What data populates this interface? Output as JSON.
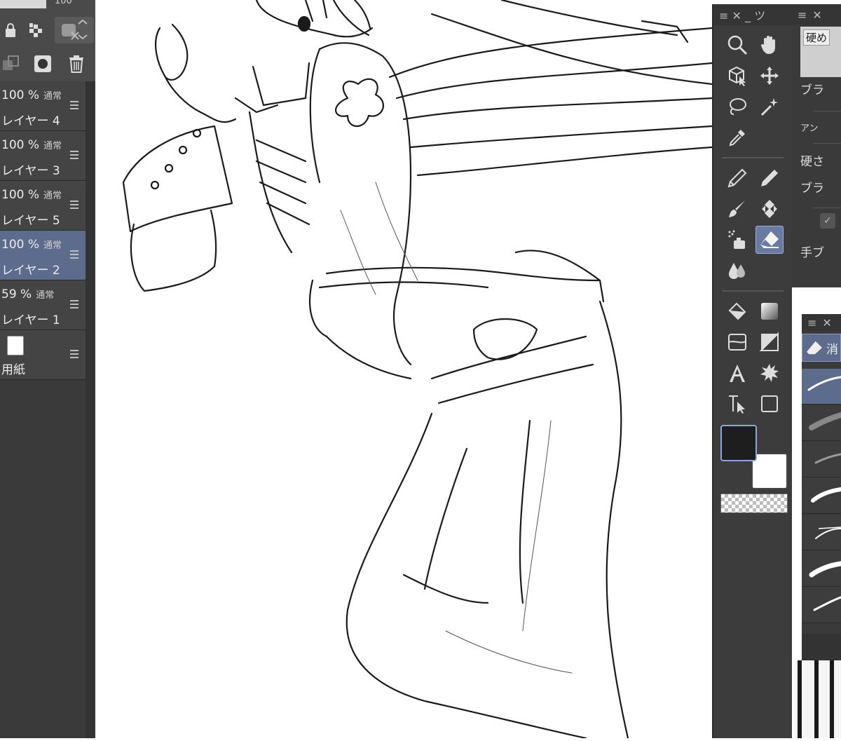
{
  "layers_panel": {
    "opacity_display": "100",
    "layers": [
      {
        "opacity": "100 %",
        "blend": "通常",
        "name": "レイヤー 4",
        "selected": false
      },
      {
        "opacity": "100 %",
        "blend": "通常",
        "name": "レイヤー 3",
        "selected": false
      },
      {
        "opacity": "100 %",
        "blend": "通常",
        "name": "レイヤー 5",
        "selected": false
      },
      {
        "opacity": "100 %",
        "blend": "通常",
        "name": "レイヤー 2",
        "selected": true
      },
      {
        "opacity": "59 %",
        "blend": "通常",
        "name": "レイヤー 1",
        "selected": false
      }
    ],
    "paper_label": "用紙"
  },
  "tool_panel": {
    "header": "≡ ✕ _ ツ",
    "tools": [
      "zoom-icon",
      "hand-icon",
      "object-select-icon",
      "move-icon",
      "lasso-icon",
      "magic-wand-icon",
      "eyedropper-icon",
      "pen-icon",
      "pencil-icon",
      "brush-icon",
      "blend-icon",
      "airbrush-icon",
      "eraser-icon",
      "decoration-icon",
      "fill-icon",
      "gradient-icon",
      "ruler-icon",
      "frame-icon",
      "text-icon",
      "balloon-icon",
      "correct-line-icon",
      "shape-icon"
    ],
    "active_tool": "eraser-icon",
    "main_color": "#1e1e1e",
    "sub_color": "#ffffff"
  },
  "property_panel": {
    "brush_name": "硬め",
    "rows": [
      "ブラ",
      "アン",
      "硬さ",
      "ブラ",
      "手ブ"
    ]
  },
  "subtool_panel": {
    "tab_label": "消"
  }
}
